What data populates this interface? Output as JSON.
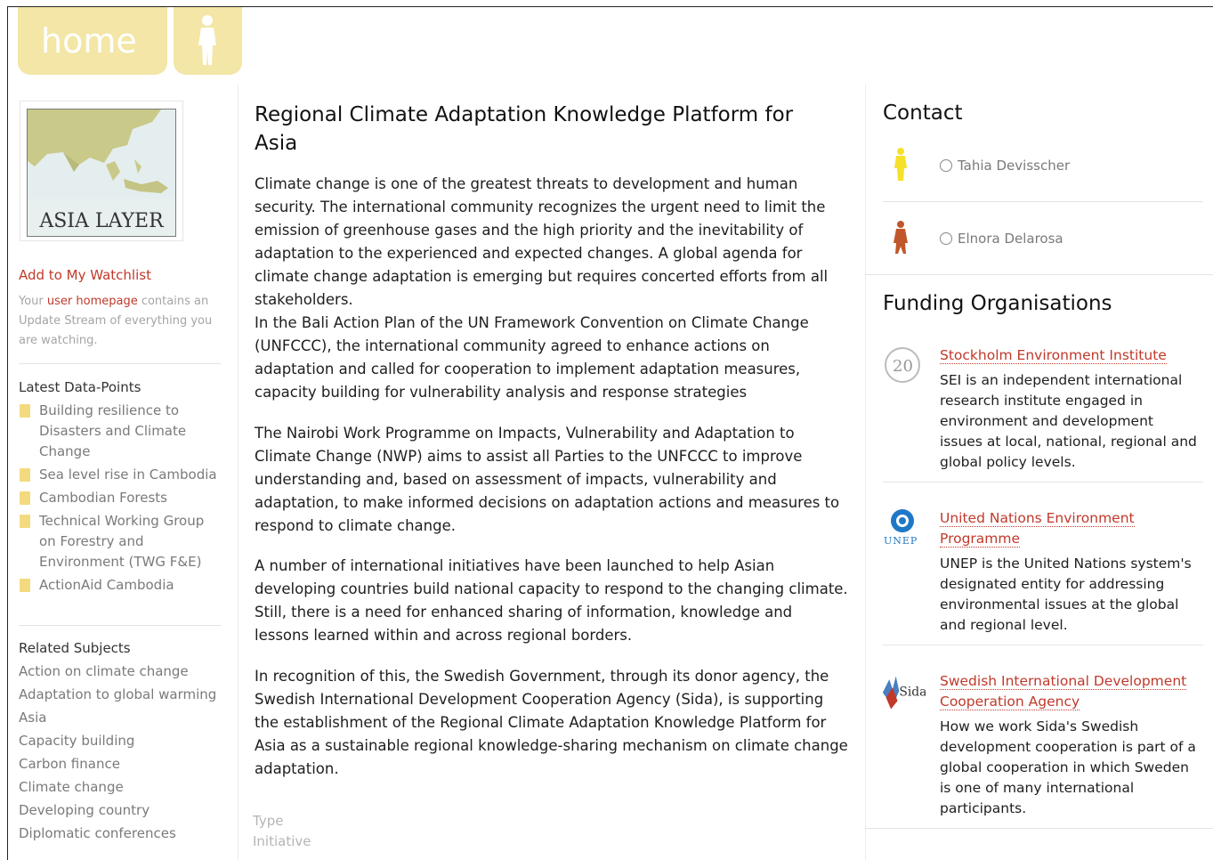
{
  "nav": {
    "home_label": "home",
    "user_icon": "person-icon"
  },
  "left": {
    "thumbnail_label": "ASIA LAYER",
    "watchlist_link": "Add to My Watchlist",
    "watch_note_pre": "Your ",
    "watch_note_link": "user homepage",
    "watch_note_post": " contains an Update Stream of everything you are watching.",
    "latest_title": "Latest Data-Points",
    "latest_items": [
      "Building resilience to Disasters and Climate Change",
      "Sea level rise in Cambodia",
      "Cambodian Forests",
      "Technical Working Group on Forestry and Environment (TWG F&E)",
      "ActionAid Cambodia"
    ],
    "related_title": "Related Subjects",
    "related_items": [
      "Action on climate change",
      "Adaptation to global warming",
      "Asia",
      "Capacity building",
      "Carbon finance",
      "Climate change",
      "Developing country",
      "Diplomatic conferences"
    ]
  },
  "main": {
    "title": "Regional Climate Adaptation Knowledge Platform for Asia",
    "p1": "Climate change is one of the greatest threats to development and human security. The international community recognizes the urgent need to limit the emission of greenhouse gases and the high priority and the inevitability of adaptation to the experienced and expected changes. A global agenda for climate change adaptation is emerging but requires concerted efforts from all stakeholders.",
    "p2": "In the Bali Action Plan of the UN Framework Convention on Climate Change (UNFCCC), the international community agreed to enhance actions on adaptation and called for cooperation to implement adaptation measures, capacity building for vulnerability analysis and response strategies",
    "p3": "The Nairobi Work Programme on Impacts, Vulnerability and Adaptation to Climate Change (NWP) aims to assist all Parties to the UNFCCC to improve understanding and, based on assessment of impacts, vulnerability and adaptation, to make informed decisions on adaptation actions and measures to respond to climate change.",
    "p4": "A number of international initiatives have been launched to help Asian developing countries build national capacity to respond to the changing climate. Still, there is a need for enhanced sharing of information, knowledge and lessons learned within and across regional borders.",
    "p5": "In recognition of this, the Swedish Government, through its donor agency, the Swedish International Development Cooperation Agency (Sida), is supporting the establishment of the Regional Climate Adaptation Knowledge Platform for Asia as a sustainable regional knowledge-sharing mechanism on climate change adaptation.",
    "type_label": "Type",
    "type_value": "Initiative"
  },
  "right": {
    "contact_title": "Contact",
    "contacts": [
      {
        "name": "Tahia Devisscher",
        "color": "#f5e02a"
      },
      {
        "name": "Elnora Delarosa",
        "color": "#c0572a"
      }
    ],
    "funding_title": "Funding Organisations",
    "orgs": [
      {
        "name": "Stockholm Environment Institute",
        "desc": "SEI is an independent international research institute engaged in environment and development issues at local, national, regional and global policy levels.",
        "logo": "sei-logo"
      },
      {
        "name": "United Nations Environment Programme",
        "desc": "UNEP is the United Nations system's designated entity for addressing environmental issues at the global and regional level.",
        "logo": "unep-logo",
        "logo_text": "UNEP"
      },
      {
        "name": "Swedish International Development Cooperation Agency",
        "desc": "How we work Sida's Swedish development cooperation is part of a global cooperation in which Sweden is one of many international participants.",
        "logo": "sida-logo",
        "logo_text": "Sida"
      }
    ]
  }
}
